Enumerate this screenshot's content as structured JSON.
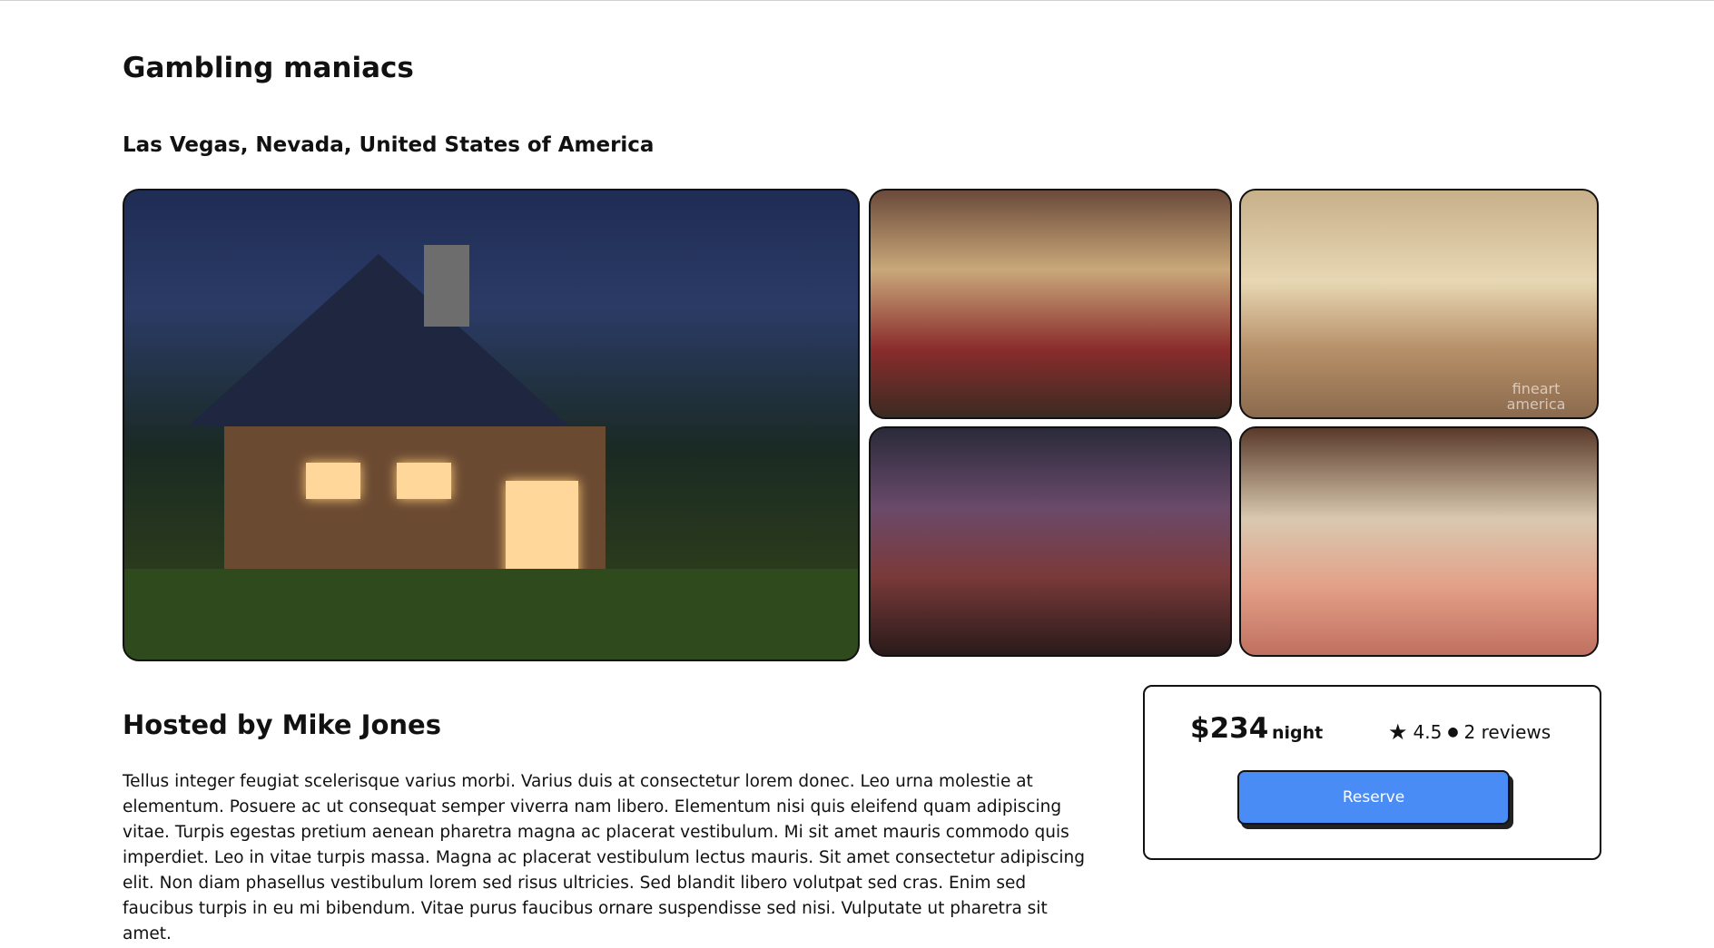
{
  "listing": {
    "title": "Gambling maniacs",
    "location": "Las Vegas, Nevada, United States of America"
  },
  "gallery": {
    "watermark": "fineart america"
  },
  "host": {
    "heading": "Hosted by Mike Jones",
    "description": "Tellus integer feugiat scelerisque varius morbi. Varius duis at consectetur lorem donec. Leo urna molestie at elementum. Posuere ac ut consequat semper viverra nam libero. Elementum nisi quis eleifend quam adipiscing vitae. Turpis egestas pretium aenean pharetra magna ac placerat vestibulum. Mi sit amet mauris commodo quis imperdiet. Leo in vitae turpis massa. Magna ac placerat vestibulum lectus mauris. Sit amet consectetur adipiscing elit. Non diam phasellus vestibulum lorem sed risus ultricies. Sed blandit libero volutpat sed cras. Enim sed faucibus turpis in eu mi bibendum. Vitae purus faucibus ornare suspendisse sed nisi. Vulputate ut pharetra sit amet."
  },
  "booking": {
    "price": "$234",
    "per": "night",
    "rating": "4.5",
    "reviews": "2 reviews",
    "reserve_label": "Reserve",
    "button_color": "#4a8cf5"
  },
  "icons": {
    "star": "star-icon",
    "dot": "dot-icon"
  }
}
